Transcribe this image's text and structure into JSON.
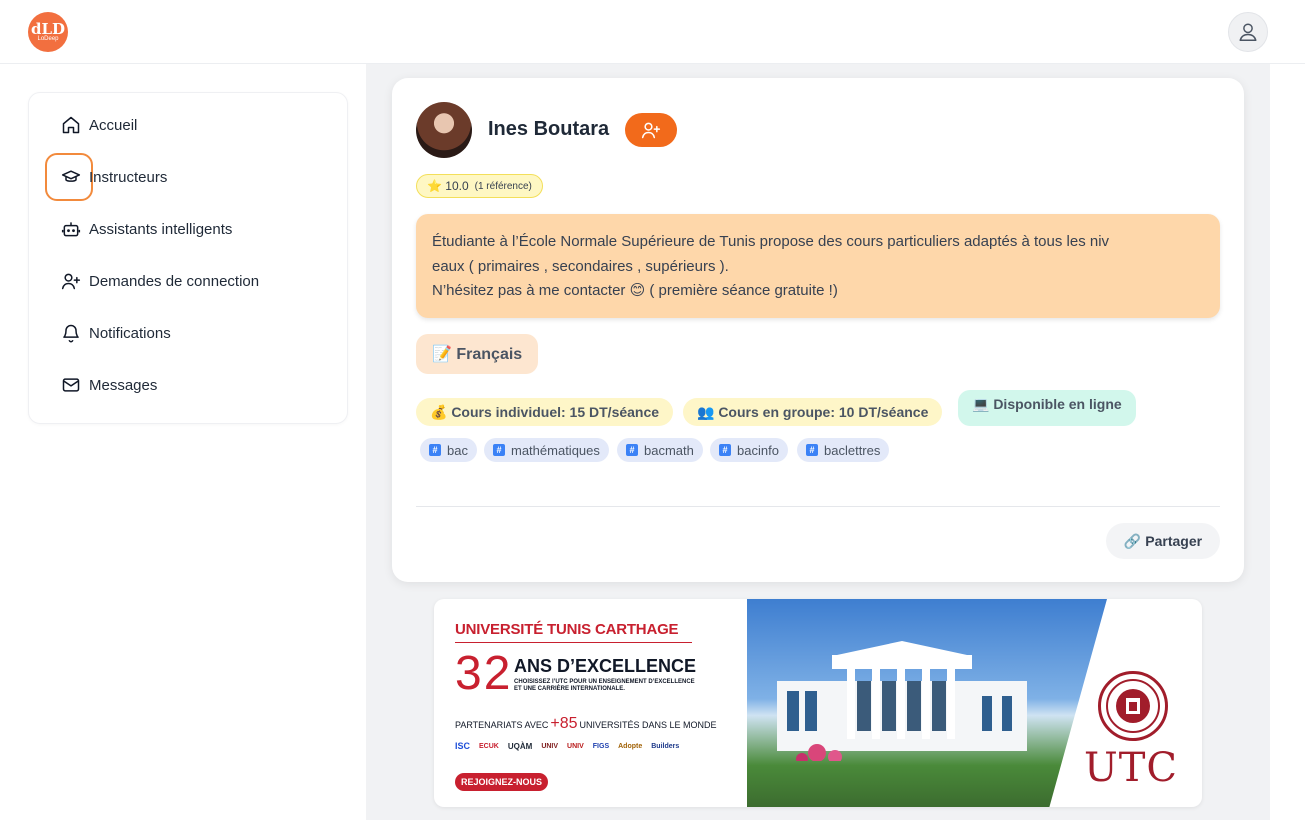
{
  "header": {
    "logo_mark": "dLD",
    "logo_sub": "LoDeep",
    "logo_color": "#f26f3f"
  },
  "sidebar": {
    "items": [
      {
        "label": "Accueil",
        "icon": "home-icon"
      },
      {
        "label": "Instructeurs",
        "icon": "graduation-cap-icon"
      },
      {
        "label": "Assistants intelligents",
        "icon": "bot-icon"
      },
      {
        "label": "Demandes de connection",
        "icon": "user-plus-icon"
      },
      {
        "label": "Notifications",
        "icon": "bell-icon"
      },
      {
        "label": "Messages",
        "icon": "mail-icon"
      }
    ]
  },
  "profile": {
    "name": "Ines Boutara",
    "rating": "⭐ 10.0",
    "rating_refs": "(1 référence)",
    "bio": "Étudiante à l’École Normale Supérieure de Tunis propose des cours particuliers adaptés à tous les niv\neaux ( primaires , secondaires , supérieurs ).\nN’hésitez pas à me contacter 😊 ( première séance gratuite !)",
    "language": "📝 Français",
    "price_individual": "💰 Cours individuel: 15 DT/séance",
    "price_group": "👥 Cours en groupe: 10 DT/séance",
    "online": "💻 Disponible en ligne",
    "tags": [
      "bac",
      "mathématiques",
      "bacmath",
      "bacinfo",
      "baclettres"
    ],
    "share_label": "🔗 Partager",
    "accent_color": "#f26a1b"
  },
  "banner": {
    "title": "UNIVERSITÉ TUNIS CARTHAGE",
    "years": "32",
    "headline": "ANS D’EXCELLENCE",
    "tagline": "CHOISISSEZ l’UTC POUR UN ENSEIGNEMENT D’EXCELLENCE\nET UNE CARRIÈRE INTERNATIONALE.",
    "partners_prefix": "PARTENARIATS AVEC",
    "partners_count": "+85",
    "partners_suffix": "UNIVERSITÉS DANS LE MONDE",
    "partner_logos": [
      "ISC",
      "ECUK",
      "UQÀM",
      "UNIV",
      "UNIV",
      "FIGS",
      "Adopte",
      "Builders"
    ],
    "cta": "REJOIGNEZ-NOUS",
    "brand": "UTC",
    "brand_color": "#c8202f"
  }
}
